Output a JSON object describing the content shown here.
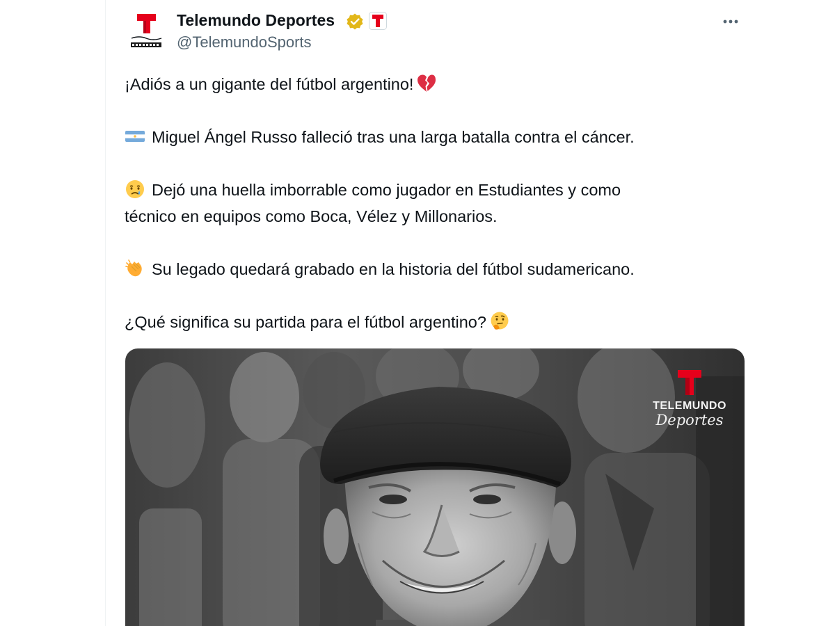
{
  "author": {
    "name": "Telemundo Deportes",
    "handle": "@TelemundoSports",
    "avatar_icon": "telemundo-deportes-ahora-logo",
    "verified_icon": "gold-verified-badge-icon",
    "affiliate_icon": "telemundo-affiliate-badge-icon"
  },
  "menu": {
    "icon": "more-horizontal-icon"
  },
  "tweet": {
    "lines": [
      {
        "text": "¡Adiós a un gigante del fútbol argentino!",
        "emoji": "broken-heart-icon",
        "emoji_position": "end"
      },
      {
        "text": "Miguel Ángel Russo falleció tras una larga batalla contra el cáncer.",
        "emoji": "argentina-flag-icon",
        "emoji_position": "start"
      },
      {
        "text": "Dejó una huella imborrable como jugador en Estudiantes y como",
        "text2": "técnico en equipos como Boca, Vélez y Millonarios.",
        "emoji": "crying-face-icon",
        "emoji_position": "start"
      },
      {
        "text": "Su legado quedará grabado en la historia del fútbol sudamericano.",
        "emoji": "clapping-hands-icon",
        "emoji_position": "start"
      },
      {
        "text": "¿Qué significa su partida para el fútbol argentino?",
        "emoji": "thinking-face-icon",
        "emoji_position": "end"
      }
    ]
  },
  "media": {
    "watermark_line1": "TELEMUNDO",
    "watermark_line2": "Deportes",
    "photo_subject": "black-and-white photo of smiling elderly man in flat cap",
    "brand_red": "#e5001b"
  },
  "colors": {
    "text_primary": "#0f1419",
    "text_secondary": "#536471",
    "verified_gold": "#e2b719"
  }
}
